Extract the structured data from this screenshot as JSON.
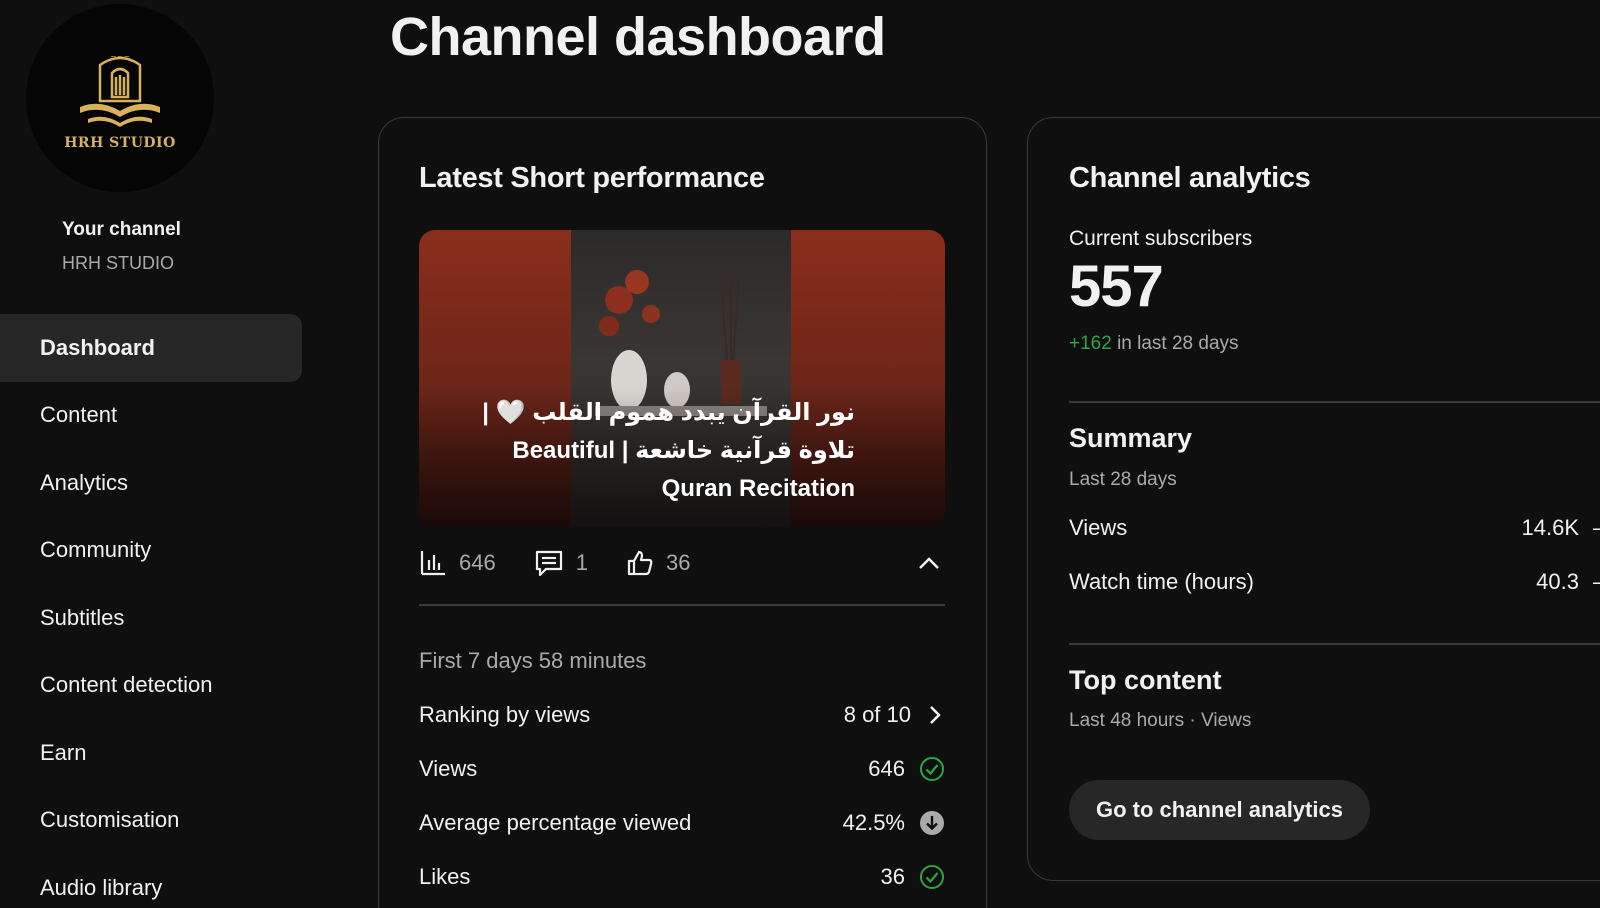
{
  "sidebar": {
    "avatar_text": "HRH STUDIO",
    "your_channel_label": "Your channel",
    "channel_name": "HRH STUDIO",
    "items": [
      {
        "label": "Dashboard",
        "active": true
      },
      {
        "label": "Content"
      },
      {
        "label": "Analytics"
      },
      {
        "label": "Community"
      },
      {
        "label": "Subtitles"
      },
      {
        "label": "Content detection"
      },
      {
        "label": "Earn"
      },
      {
        "label": "Customisation"
      },
      {
        "label": "Audio library"
      }
    ]
  },
  "page_title": "Channel dashboard",
  "latest_short": {
    "card_title": "Latest Short performance",
    "video_title": "نور القرآن يبدد هموم القلب 🤍 | تلاوة قرآنية خاشعة | Beautiful Quran Recitation",
    "stats": {
      "views": "646",
      "comments": "1",
      "likes": "36"
    },
    "period_label": "First 7 days 58 minutes",
    "metrics": [
      {
        "label": "Ranking by views",
        "value": "8 of 10",
        "icon": "chevron-right-icon"
      },
      {
        "label": "Views",
        "value": "646",
        "icon": "check-circle-icon"
      },
      {
        "label": "Average percentage viewed",
        "value": "42.5%",
        "icon": "arrow-down-circle-icon"
      },
      {
        "label": "Likes",
        "value": "36",
        "icon": "check-circle-icon"
      }
    ]
  },
  "channel_analytics": {
    "card_title": "Channel analytics",
    "subscribers_label": "Current subscribers",
    "subscribers_value": "557",
    "delta_value": "+162",
    "delta_suffix": " in last 28 days",
    "summary_title": "Summary",
    "summary_period": "Last 28 days",
    "summary_rows": [
      {
        "label": "Views",
        "value": "14.6K",
        "trend": "—"
      },
      {
        "label": "Watch time (hours)",
        "value": "40.3",
        "trend": "—"
      }
    ],
    "top_content_title": "Top content",
    "top_content_period": "Last 48 hours · Views",
    "button_label": "Go to channel analytics"
  },
  "colors": {
    "background": "#0f0f0f",
    "positive": "#2ba640",
    "muted_text": "#aaaaaa",
    "surface": "#272727"
  }
}
